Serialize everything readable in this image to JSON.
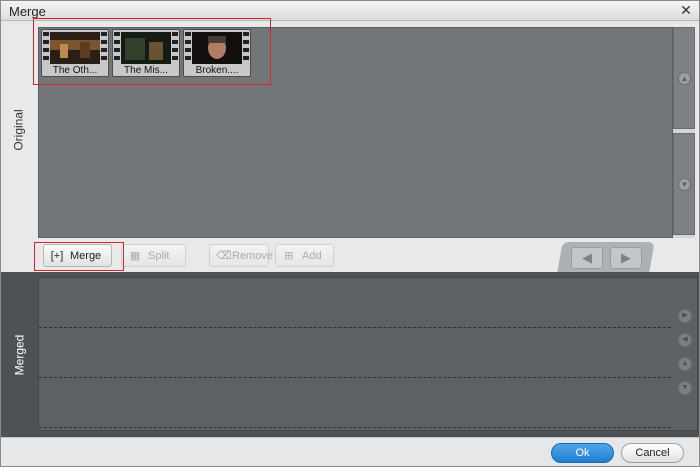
{
  "window": {
    "title": "Merge",
    "close_glyph": "✕"
  },
  "original": {
    "label": "Original",
    "clips": [
      {
        "caption": "The Oth...",
        "tint": "#7a5530"
      },
      {
        "caption": "The Mis...",
        "tint": "#34402e"
      },
      {
        "caption": "Broken....",
        "tint": "#4a3a35"
      }
    ],
    "scroll_up_glyph": "▲",
    "scroll_down_glyph": "▼"
  },
  "toolbar": {
    "merge_label": "Merge",
    "split_label": "Split",
    "remove_label": "Remove",
    "add_label": "Add",
    "merge_icon": "[+]",
    "split_icon": "▦",
    "remove_icon": "⌫",
    "add_icon": "⊞",
    "left_arrow": "◀",
    "right_arrow": "▶"
  },
  "merged": {
    "label": "Merged",
    "controls": [
      "▶",
      "◀",
      "▲",
      "▼"
    ]
  },
  "footer": {
    "ok_label": "Ok",
    "cancel_label": "Cancel"
  },
  "colors": {
    "highlight": "#d9222a",
    "ok_button": "#2b88d8"
  }
}
